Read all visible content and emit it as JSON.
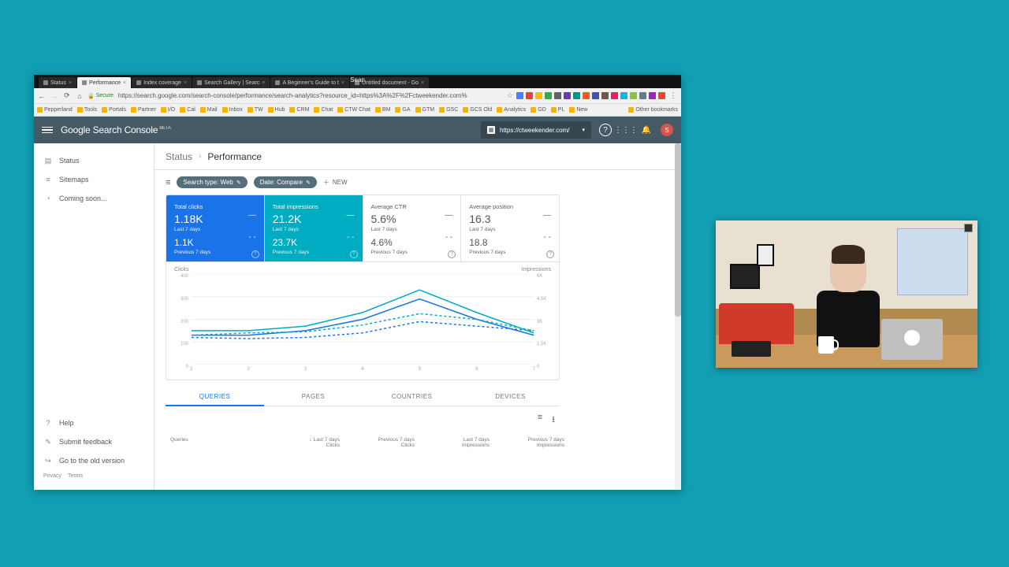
{
  "window": {
    "title": "Sean"
  },
  "tabs": [
    {
      "label": "Status"
    },
    {
      "label": "Performance"
    },
    {
      "label": "Index coverage"
    },
    {
      "label": "Search Gallery | Searc"
    },
    {
      "label": "A Beginner's Guide to t"
    },
    {
      "label": "Untitled document - Go"
    }
  ],
  "address": {
    "secure_label": "Secure",
    "url": "https://search.google.com/search-console/performance/search-analytics?resource_id=https%3A%2F%2Fctweekender.com%"
  },
  "bookmarks": [
    "Pepperland",
    "Tools",
    "Portals",
    "Partner",
    "I/O",
    "Cal",
    "Mail",
    "Inbox",
    "TW",
    "Hub",
    "CRM",
    "Chat",
    "CTW Chat",
    "BM",
    "GA",
    "GTM",
    "GSC",
    "GCS Old",
    "Analytics",
    "GD",
    "PL",
    "New"
  ],
  "bookmarks_right": "Other bookmarks",
  "header": {
    "product": "Google Search Console",
    "beta": "BETA",
    "property": "https://ctweekender.com/"
  },
  "sidebar": {
    "status": "Status",
    "sitemaps": "Sitemaps",
    "coming": "Coming soon...",
    "help": "Help",
    "feedback": "Submit feedback",
    "old": "Go to the old version",
    "privacy": "Privacy",
    "terms": "Terms"
  },
  "breadcrumb": {
    "a": "Status",
    "b": "Performance"
  },
  "filters": {
    "chip1": "Search type: Web",
    "chip2": "Date: Compare",
    "new": "NEW"
  },
  "cards": {
    "clicks": {
      "title": "Total clicks",
      "v1": "1.18K",
      "s1": "Last 7 days",
      "d1": "—",
      "v2": "1.1K",
      "s2": "Previous 7 days",
      "d2": "- -"
    },
    "impr": {
      "title": "Total impressions",
      "v1": "21.2K",
      "s1": "Last 7 days",
      "d1": "—",
      "v2": "23.7K",
      "s2": "Previous 7 days",
      "d2": "- -"
    },
    "ctr": {
      "title": "Average CTR",
      "v1": "5.6%",
      "s1": "Last 7 days",
      "d1": "—",
      "v2": "4.6%",
      "s2": "Previous 7 days",
      "d2": "- -"
    },
    "pos": {
      "title": "Average position",
      "v1": "16.3",
      "s1": "Last 7 days",
      "d1": "—",
      "v2": "18.8",
      "s2": "Previous 7 days",
      "d2": "- -"
    }
  },
  "chart": {
    "left_label": "Clicks",
    "right_label": "Impressions",
    "y_left": [
      "400",
      "300",
      "200",
      "100",
      "0"
    ],
    "y_right": [
      "6K",
      "4.5K",
      "3K",
      "1.5K",
      "0"
    ],
    "x": [
      "1",
      "2",
      "3",
      "4",
      "5",
      "6",
      "7"
    ]
  },
  "chart_data": {
    "type": "line",
    "x": [
      1,
      2,
      3,
      4,
      5,
      6,
      7
    ],
    "left_axis": {
      "label": "Clicks",
      "range": [
        0,
        400
      ]
    },
    "right_axis": {
      "label": "Impressions",
      "range": [
        0,
        6000
      ]
    },
    "series": [
      {
        "name": "Clicks – Last 7 days",
        "axis": "left",
        "style": "solid",
        "color": "#1a73e8",
        "values": [
          130,
          130,
          150,
          200,
          290,
          200,
          130
        ]
      },
      {
        "name": "Clicks – Previous 7 days",
        "axis": "left",
        "style": "dashed",
        "color": "#1a73e8",
        "values": [
          120,
          115,
          120,
          140,
          190,
          170,
          150
        ]
      },
      {
        "name": "Impressions – Last 7 days",
        "axis": "left_scaled_as_right",
        "style": "solid",
        "color": "#00acc1",
        "values": [
          150,
          150,
          170,
          230,
          330,
          230,
          140
        ]
      },
      {
        "name": "Impressions – Previous 7 days",
        "axis": "left_scaled_as_right",
        "style": "dashed",
        "color": "#00acc1",
        "values": [
          130,
          140,
          145,
          175,
          225,
          200,
          150
        ]
      }
    ],
    "note": "Impressions series plotted against right axis; values shown here are on the left-axis pixel scale as rendered."
  },
  "tabs_lower": {
    "q": "QUERIES",
    "p": "PAGES",
    "c": "COUNTRIES",
    "d": "DEVICES"
  },
  "table": {
    "queries": "Queries",
    "h1a": "Last 7 days",
    "h1b": "Clicks",
    "h2a": "Previous 7 days",
    "h2b": "Clicks",
    "h3a": "Last 7 days",
    "h3b": "Impressions",
    "h4a": "Previous 7 days",
    "h4b": "Impressions"
  },
  "ext_colors": [
    "#4285f4",
    "#ea4335",
    "#fbbc05",
    "#34a853",
    "#5f6368",
    "#673ab7",
    "#009688",
    "#ff5722",
    "#3f51b5",
    "#795548",
    "#e91e63",
    "#00bcd4",
    "#8bc34a",
    "#607d8b",
    "#9c27b0",
    "#f44336"
  ]
}
